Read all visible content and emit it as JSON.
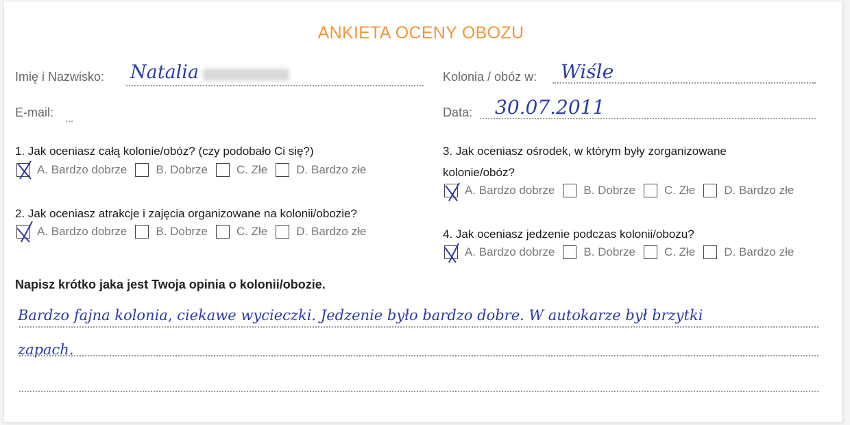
{
  "form": {
    "title": "ANKIETA OCENY OBOZU",
    "fields": {
      "name_label": "Imię i Nazwisko:",
      "name_value": "Natalia",
      "email_label": "E-mail:",
      "camp_label": "Kolonia / obóz w:",
      "camp_value": "Wiśle",
      "date_label": "Data:",
      "date_value": "30.07.2011"
    },
    "options": [
      "A. Bardzo dobrze",
      "B. Dobrze",
      "C. Złe",
      "D. Bardzo złe"
    ],
    "questions": [
      {
        "text": "1. Jak oceniasz całą kolonie/obóz? (czy podobało Ci się?)",
        "selected": "A. Bardzo dobrze"
      },
      {
        "text": "2.  Jak oceniasz atrakcje i zajęcia organizowane na kolonii/obozie?",
        "selected": "A. Bardzo dobrze"
      },
      {
        "text_line1": "3. Jak oceniasz ośrodek, w którym były zorganizowane",
        "text_line2": "kolonie/obóz?",
        "selected": "A. Bardzo dobrze"
      },
      {
        "text": "4.  Jak oceniasz jedzenie podczas kolonii/obozu?",
        "selected": "A. Bardzo dobrze"
      }
    ],
    "opinion": {
      "prompt": "Napisz krótko jaka jest Twoja opinia o kolonii/obozie.",
      "line1": "Bardzo fajna kolonia, ciekawe wycieczki. Jedzenie było bardzo dobre. W autokarze był brzytki",
      "line2": "zapach."
    }
  }
}
